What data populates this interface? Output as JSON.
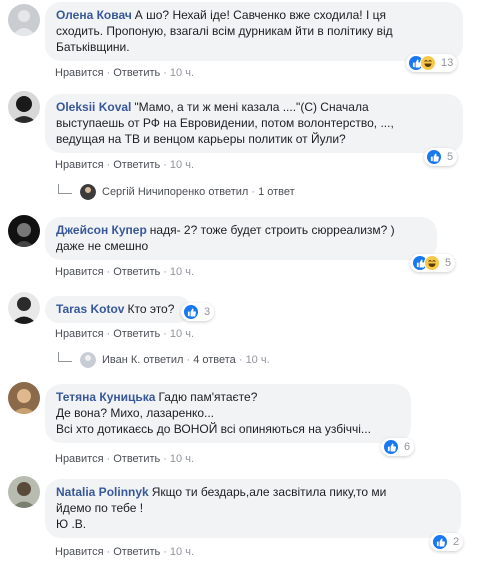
{
  "comments": [
    {
      "author": "Олена Ковач",
      "lines": [
        "А шо? Нехай іде! Савченко вже сходила! І ця",
        "сходить. Пропоную, взагалі всім дурникам йти в політику від",
        "Батьківщини."
      ],
      "like": "Нравится",
      "reply": "Ответить",
      "time": "10 ч.",
      "reaction_count": "13",
      "reaction_icons": [
        "like-icon",
        "haha-icon"
      ]
    },
    {
      "author": "Oleksii Koval",
      "lines": [
        "\"Мамо, а ти ж мені казала ....\"(С) Сначала",
        "выступаешь от РФ на Евровидении, потом волонтерство, ...,",
        "ведущая на ТВ и венцом карьеры политик от Йули?"
      ],
      "like": "Нравится",
      "reply": "Ответить",
      "time": "10 ч.",
      "reaction_count": "5",
      "reaction_icons": [
        "like-icon"
      ],
      "thread": {
        "user": "Сергій Ничипоренко",
        "verb": "ответил",
        "count": "1 ответ",
        "time": ""
      }
    },
    {
      "author": "Джейсон Купер",
      "lines": [
        "надя- 2? тоже будет строить сюрреализм? )",
        "даже не смешно"
      ],
      "like": "Нравится",
      "reply": "Ответить",
      "time": "10 ч.",
      "reaction_count": "5",
      "reaction_icons": [
        "like-icon",
        "haha-icon"
      ]
    },
    {
      "author": "Taras Kotov",
      "lines": [
        "Кто это?"
      ],
      "like": "Нравится",
      "reply": "Ответить",
      "time": "10 ч.",
      "reaction_count": "3",
      "reaction_icons": [
        "like-icon"
      ],
      "thread": {
        "user": "Иван К.",
        "verb": "ответил",
        "count": "4 ответа",
        "time": "10 ч."
      }
    },
    {
      "author": "Тетяна Куницька",
      "lines": [
        "Гадю пам'ятаєте?",
        "Де вона? Михо, лазаренко...",
        "Всі хто дотикаєсь до ВОНОЙ всі опиняються на узбіччі..."
      ],
      "like": "Нравится",
      "reply": "Ответить",
      "time": "10 ч.",
      "reaction_count": "6",
      "reaction_icons": [
        "like-icon"
      ]
    },
    {
      "author": "Natalia Polinnyk",
      "lines": [
        "Якщо ти бездарь,але засвітила пику,то ми",
        "йдемо по тебе !",
        "Ю .В."
      ],
      "like": "Нравится",
      "reply": "Ответить",
      "time": "10 ч.",
      "reaction_count": "2",
      "reaction_icons": [
        "like-icon"
      ]
    }
  ]
}
